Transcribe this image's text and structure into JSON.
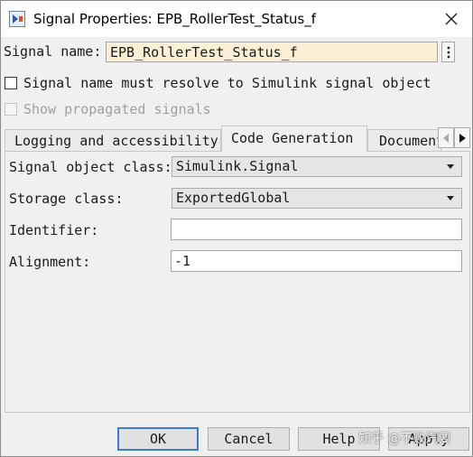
{
  "window": {
    "title": "Signal Properties: EPB_RollerTest_Status_f",
    "icon": "simulink-signal-icon",
    "close_icon": "close-icon"
  },
  "signal_name": {
    "label": "Signal name:",
    "value": "EPB_RollerTest_Status_f",
    "menu_icon": "kebab-menu-icon"
  },
  "checkboxes": {
    "must_resolve": {
      "label": "Signal name must resolve to Simulink signal object",
      "checked": false
    },
    "show_propagated": {
      "label": "Show propagated signals",
      "checked": false,
      "enabled": false
    }
  },
  "tabs": [
    {
      "label": "Logging and accessibility",
      "active": false
    },
    {
      "label": "Code Generation",
      "active": true
    },
    {
      "label": "Documentation",
      "active": false
    }
  ],
  "tab_scroll": {
    "left_icon": "chevron-left-icon",
    "right_icon": "chevron-right-icon"
  },
  "code_generation": {
    "signal_object_class": {
      "label": "Signal object class:",
      "value": "Simulink.Signal"
    },
    "storage_class": {
      "label": "Storage class:",
      "value": "ExportedGlobal"
    },
    "identifier": {
      "label": "Identifier:",
      "value": ""
    },
    "alignment": {
      "label": "Alignment:",
      "value": "-1"
    }
  },
  "buttons": {
    "ok": "OK",
    "cancel": "Cancel",
    "help": "Help",
    "apply": "Apply"
  },
  "watermark": "知乎 @不败汽要"
}
